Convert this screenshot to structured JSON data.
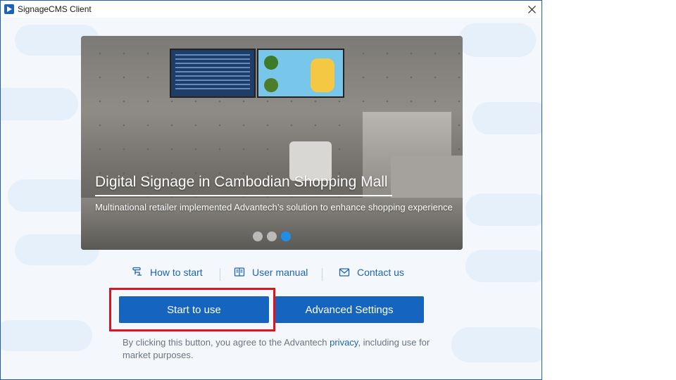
{
  "window": {
    "title": "SignageCMS Client"
  },
  "carousel": {
    "slide_title": "Digital Signage in Cambodian Shopping Mall",
    "slide_description": "Multinational retailer implemented Advantech’s solution to enhance shopping experience",
    "dot_count": 3,
    "active_dot": 3
  },
  "links": {
    "how_to_start": "How to start",
    "user_manual": "User manual",
    "contact_us": "Contact us"
  },
  "buttons": {
    "start_label": "Start to use",
    "advanced_label": "Advanced Settings"
  },
  "consent": {
    "text_before": "By clicking this button, you agree to the Advantech ",
    "privacy_link": "privacy",
    "text_after": ",  including use for market purposes."
  },
  "colors": {
    "accent": "#1565c0",
    "link": "#1e62b4",
    "highlight": "#e0141e",
    "active_dot": "#1e8ee8"
  },
  "icons": [
    "app-logo-icon",
    "close-icon",
    "tutorial-icon",
    "book-icon",
    "mail-icon"
  ]
}
